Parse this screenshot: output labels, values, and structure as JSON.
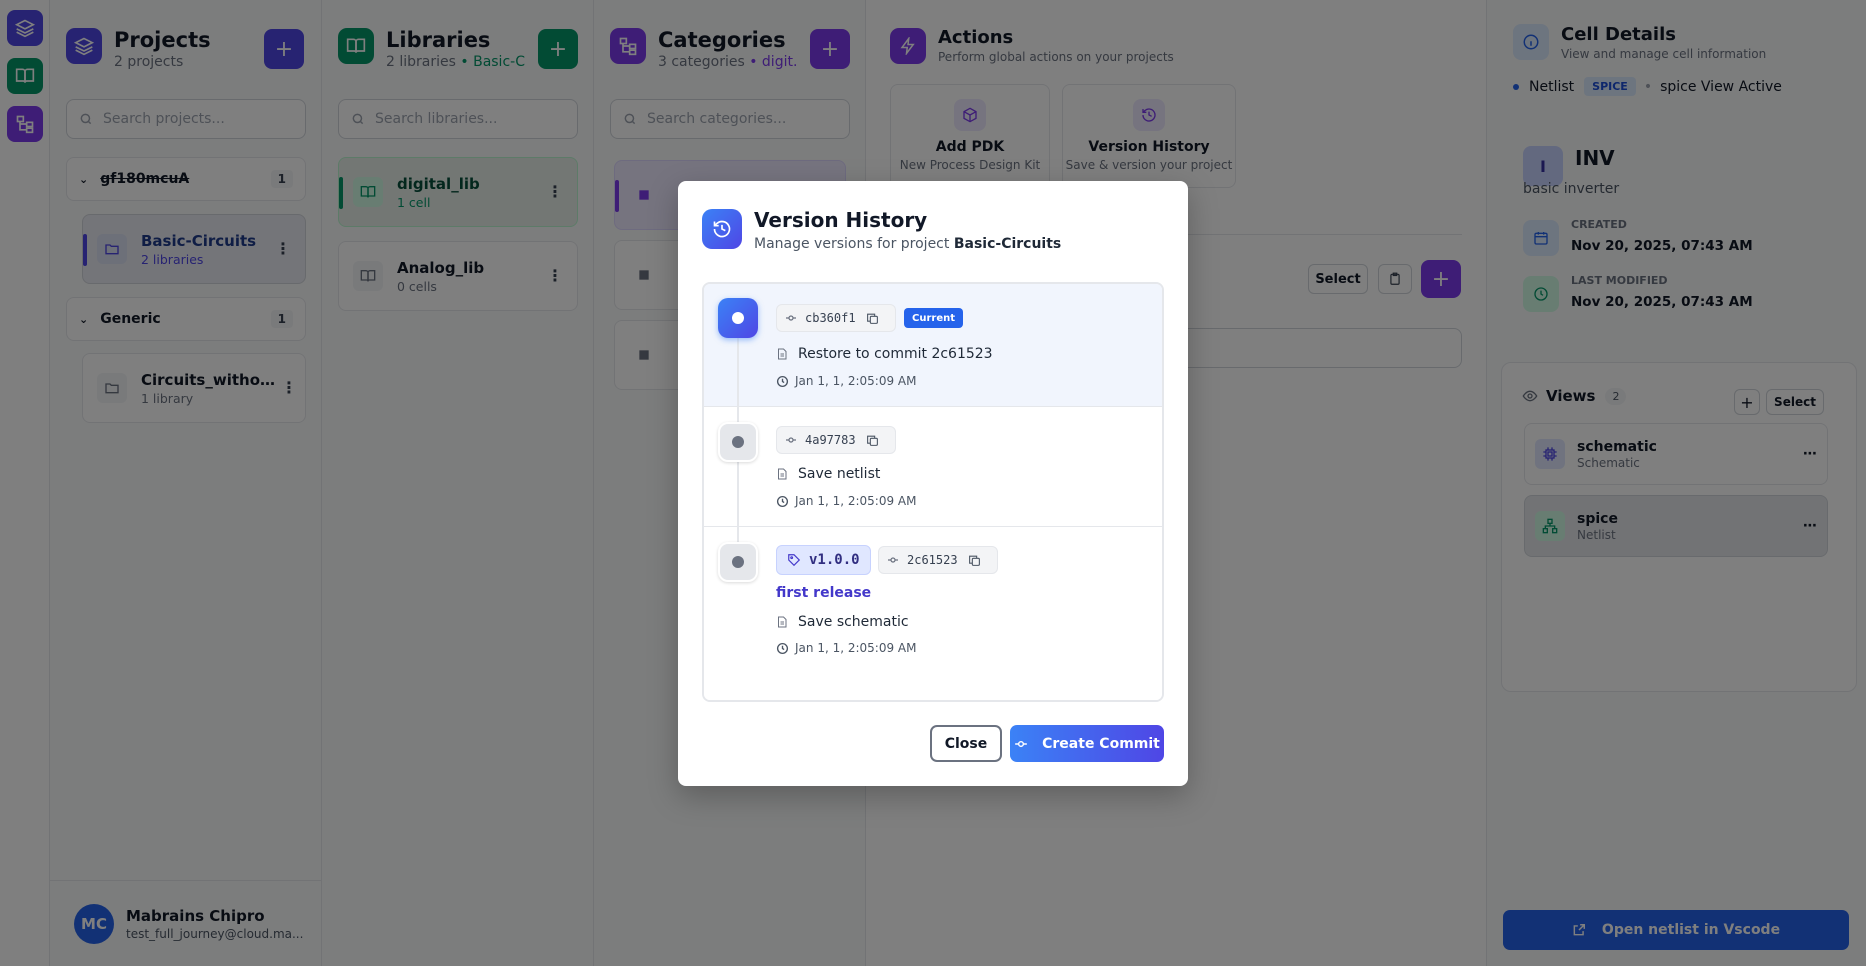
{
  "rail": {
    "icons": [
      "layers-icon",
      "book-icon",
      "hierarchy-icon"
    ]
  },
  "projects": {
    "title": "Projects",
    "subtitle": "2 projects",
    "search_placeholder": "Search projects...",
    "groups": [
      {
        "name": "gf180mcuA",
        "count": "1",
        "items": [
          {
            "name": "Basic-Circuits",
            "sub": "2 libraries"
          }
        ]
      },
      {
        "name": "Generic",
        "count": "1",
        "items": [
          {
            "name": "Circuits_without...",
            "sub": "1 library"
          }
        ]
      }
    ]
  },
  "libraries": {
    "title": "Libraries",
    "subtitle": "2 libraries",
    "subtitle_accent": "• Basic-C...",
    "search_placeholder": "Search libraries...",
    "items": [
      {
        "name": "digital_lib",
        "sub": "1 cell"
      },
      {
        "name": "Analog_lib",
        "sub": "0 cells"
      }
    ]
  },
  "categories": {
    "title": "Categories",
    "subtitle": "3 categories",
    "subtitle_accent": "• digit...",
    "search_placeholder": "Search categories..."
  },
  "actions": {
    "title": "Actions",
    "subtitle": "Perform global actions on your projects",
    "cards": [
      {
        "title": "Add PDK",
        "sub": "New Process Design Kit"
      },
      {
        "title": "Version History",
        "sub": "Save & version your project"
      }
    ],
    "select_label": "Select"
  },
  "cell_details": {
    "title": "Cell Details",
    "subtitle": "View and manage cell information",
    "view_type": "Netlist",
    "view_badge": "SPICE",
    "view_active": "spice View Active",
    "cell_initial": "I",
    "cell_name": "INV",
    "cell_desc": "basic inverter",
    "created_label": "CREATED",
    "created_value": "Nov 20, 2025, 07:43 AM",
    "modified_label": "LAST MODIFIED",
    "modified_value": "Nov 20, 2025, 07:43 AM",
    "views_label": "Views",
    "views_count": "2",
    "select_label": "Select",
    "views": [
      {
        "name": "schematic",
        "type": "Schematic"
      },
      {
        "name": "spice",
        "type": "Netlist"
      }
    ],
    "open_button": "Open netlist in Vscode"
  },
  "user": {
    "initials": "MC",
    "name": "Mabrains Chipro",
    "email": "test_full_journey@cloud.ma..."
  },
  "modal": {
    "title": "Version History",
    "subtitle_prefix": "Manage versions for project",
    "project": "Basic-Circuits",
    "commits": [
      {
        "hash": "cb360f1",
        "badge": "Current",
        "message": "Restore to commit 2c61523",
        "time": "Jan 1, 1, 2:05:09 AM"
      },
      {
        "hash": "4a97783",
        "message": "Save netlist",
        "time": "Jan 1, 1, 2:05:09 AM"
      },
      {
        "tag": "v1.0.0",
        "hash": "2c61523",
        "tag_message": "first release",
        "message": "Save schematic",
        "time": "Jan 1, 1, 2:05:09 AM"
      }
    ],
    "close_label": "Close",
    "commit_label": "Create Commit"
  }
}
